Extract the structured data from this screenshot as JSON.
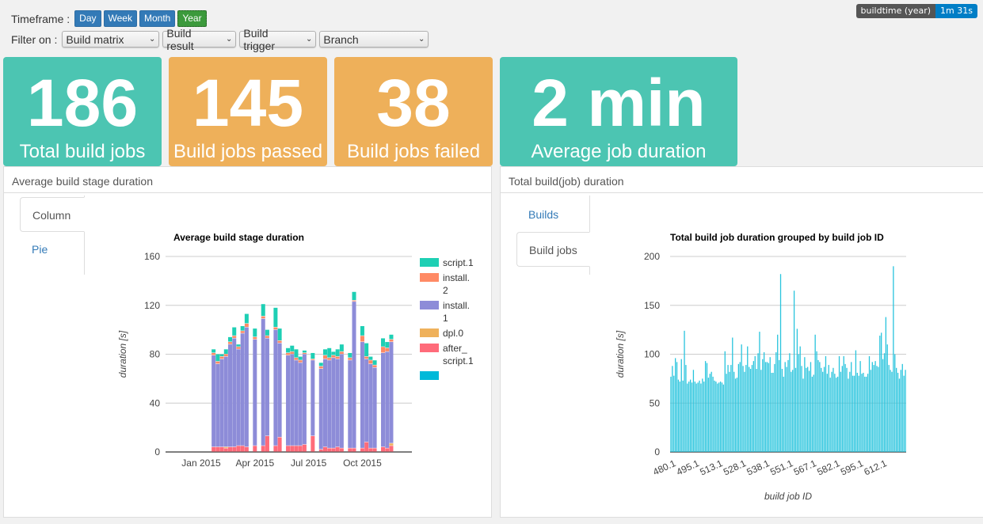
{
  "toolbar": {
    "timeframe_label": "Timeframe :",
    "timeframe_buttons": [
      {
        "label": "Day",
        "active": false
      },
      {
        "label": "Week",
        "active": false
      },
      {
        "label": "Month",
        "active": false
      },
      {
        "label": "Year",
        "active": true
      }
    ],
    "filter_label": "Filter on :",
    "filters": [
      {
        "value": "Build matrix"
      },
      {
        "value": "Build result"
      },
      {
        "value": "Build trigger"
      },
      {
        "value": "Branch"
      }
    ]
  },
  "badge": {
    "key": "buildtime (year)",
    "value": "1m 31s"
  },
  "cards": [
    {
      "value": "186",
      "caption": "Total build jobs",
      "color": "#4cc5b2"
    },
    {
      "value": "145",
      "caption": "Build jobs passed",
      "color": "#eeb05a"
    },
    {
      "value": "38",
      "caption": "Build jobs failed",
      "color": "#eeb05a"
    },
    {
      "value": "2 min",
      "caption": "Average job duration",
      "color": "#4cc5b2"
    }
  ],
  "left_panel": {
    "title": "Average build stage duration",
    "tabs": [
      {
        "label": "Column",
        "active": true
      },
      {
        "label": "Pie",
        "active": false
      }
    ]
  },
  "right_panel": {
    "title": "Total build(job) duration",
    "tabs": [
      {
        "label": "Builds",
        "active": false
      },
      {
        "label": "Build jobs",
        "active": true
      }
    ]
  },
  "chart_data": [
    {
      "type": "bar",
      "stacked": true,
      "title": "Average build stage duration",
      "xlabel": "",
      "ylabel": "duration [s]",
      "ylim": [
        0,
        160
      ],
      "yticks": [
        0,
        40,
        80,
        120,
        160
      ],
      "xticks": [
        "Jan 2015",
        "Apr 2015",
        "Jul 2015",
        "Oct 2015"
      ],
      "x_range_weeks": [
        -3,
        49
      ],
      "grid": true,
      "legend": "right",
      "series": [
        {
          "name": "after_\nscript.1",
          "color": "#ff6b7a"
        },
        {
          "name": "dpl.0",
          "color": "#efb15b"
        },
        {
          "name": "install.1",
          "color": "#8d8cd8"
        },
        {
          "name": "install.2",
          "color": "#ff8a65"
        },
        {
          "name": "script.1",
          "color": "#1ecfb4"
        },
        {
          "name": "",
          "color": "#00b9d9"
        }
      ],
      "legend_order": [
        "script.1",
        "install.\n2",
        "install.\n1",
        "dpl.0",
        "after_\nscript.1",
        ""
      ],
      "weeks": [
        {
          "w": 3,
          "after": 4,
          "dpl": 0,
          "inst1": 75,
          "inst2": 2,
          "script": 3
        },
        {
          "w": 4,
          "after": 4,
          "dpl": 0,
          "inst1": 68,
          "inst2": 2,
          "script": 6
        },
        {
          "w": 5,
          "after": 4,
          "dpl": 0,
          "inst1": 72,
          "inst2": 2,
          "script": 2
        },
        {
          "w": 6,
          "after": 3,
          "dpl": 1,
          "inst1": 74,
          "inst2": 2,
          "script": 4
        },
        {
          "w": 7,
          "after": 4,
          "dpl": 0,
          "inst1": 84,
          "inst2": 2,
          "script": 4
        },
        {
          "w": 8,
          "after": 4,
          "dpl": 0,
          "inst1": 89,
          "inst2": 2,
          "script": 7
        },
        {
          "w": 9,
          "after": 5,
          "dpl": 0,
          "inst1": 79,
          "inst2": 2,
          "script": 2
        },
        {
          "w": 10,
          "after": 5,
          "dpl": 0,
          "inst1": 92,
          "inst2": 2,
          "script": 4
        },
        {
          "w": 11,
          "after": 4,
          "dpl": 0,
          "inst1": 98,
          "inst2": 3,
          "script": 8
        },
        {
          "w": 13,
          "after": 5,
          "dpl": 0,
          "inst1": 87,
          "inst2": 2,
          "script": 7
        },
        {
          "w": 15,
          "after": 5,
          "dpl": 0,
          "inst1": 104,
          "inst2": 2,
          "script": 10
        },
        {
          "w": 16,
          "after": 13,
          "dpl": 0,
          "inst1": 80,
          "inst2": 2,
          "script": 5
        },
        {
          "w": 18,
          "after": 5,
          "dpl": 0,
          "inst1": 95,
          "inst2": 2,
          "script": 16
        },
        {
          "w": 19,
          "after": 12,
          "dpl": 0,
          "inst1": 77,
          "inst2": 2,
          "script": 10
        },
        {
          "w": 21,
          "after": 5,
          "dpl": 0,
          "inst1": 74,
          "inst2": 2,
          "script": 4
        },
        {
          "w": 22,
          "after": 5,
          "dpl": 0,
          "inst1": 75,
          "inst2": 2,
          "script": 5
        },
        {
          "w": 23,
          "after": 5,
          "dpl": 0,
          "inst1": 70,
          "inst2": 2,
          "script": 7
        },
        {
          "w": 24,
          "after": 5,
          "dpl": 0,
          "inst1": 68,
          "inst2": 2,
          "script": 3
        },
        {
          "w": 25,
          "after": 6,
          "dpl": 0,
          "inst1": 74,
          "inst2": 1,
          "script": 2
        },
        {
          "w": 27,
          "after": 13,
          "dpl": 0,
          "inst1": 62,
          "inst2": 1,
          "script": 5
        },
        {
          "w": 29,
          "after": 2,
          "dpl": 0,
          "inst1": 66,
          "inst2": 2,
          "script": 3
        },
        {
          "w": 30,
          "after": 4,
          "dpl": 0,
          "inst1": 72,
          "inst2": 3,
          "script": 5
        },
        {
          "w": 31,
          "after": 3,
          "dpl": 0,
          "inst1": 72,
          "inst2": 2,
          "script": 8
        },
        {
          "w": 32,
          "after": 3,
          "dpl": 0,
          "inst1": 74,
          "inst2": 2,
          "script": 3
        },
        {
          "w": 33,
          "after": 4,
          "dpl": 0,
          "inst1": 72,
          "inst2": 2,
          "script": 6
        },
        {
          "w": 34,
          "after": 3,
          "dpl": 0,
          "inst1": 77,
          "inst2": 2,
          "script": 6
        },
        {
          "w": 36,
          "after": 3,
          "dpl": 0,
          "inst1": 72,
          "inst2": 2,
          "script": 4
        },
        {
          "w": 37,
          "after": 3,
          "dpl": 0,
          "inst1": 120,
          "inst2": 1,
          "script": 7
        },
        {
          "w": 39,
          "after": 3,
          "dpl": 0,
          "inst1": 87,
          "inst2": 5,
          "script": 8
        },
        {
          "w": 40,
          "after": 8,
          "dpl": 0,
          "inst1": 68,
          "inst2": 2,
          "script": 11
        },
        {
          "w": 41,
          "after": 3,
          "dpl": 0,
          "inst1": 69,
          "inst2": 3,
          "script": 3
        },
        {
          "w": 42,
          "after": 3,
          "dpl": 0,
          "inst1": 66,
          "inst2": 2,
          "script": 4
        },
        {
          "w": 44,
          "after": 4,
          "dpl": 0,
          "inst1": 77,
          "inst2": 5,
          "script": 7
        },
        {
          "w": 45,
          "after": 3,
          "dpl": 0,
          "inst1": 79,
          "inst2": 3,
          "script": 5
        },
        {
          "w": 46,
          "after": 5,
          "dpl": 2,
          "inst1": 83,
          "inst2": 2,
          "script": 4
        }
      ]
    },
    {
      "type": "bar",
      "title": "Total build job duration grouped by build job ID",
      "xlabel": "build job ID",
      "ylabel": "duration [s]",
      "ylim": [
        0,
        200
      ],
      "yticks": [
        0,
        50,
        100,
        150,
        200
      ],
      "xticks": [
        "480.1",
        "495.1",
        "513.1",
        "528.1",
        "538.1",
        "551.1",
        "567.1",
        "582.1",
        "595.1",
        "612.1"
      ],
      "grid": true,
      "legend": "none",
      "color": "#28c4dd",
      "values": [
        77,
        88,
        78,
        96,
        92,
        74,
        72,
        95,
        73,
        124,
        89,
        70,
        72,
        74,
        71,
        84,
        72,
        70,
        71,
        73,
        70,
        75,
        72,
        93,
        91,
        76,
        80,
        82,
        77,
        73,
        72,
        70,
        71,
        72,
        71,
        69,
        103,
        80,
        89,
        82,
        89,
        117,
        82,
        75,
        76,
        90,
        92,
        110,
        88,
        82,
        89,
        108,
        87,
        85,
        89,
        93,
        98,
        85,
        101,
        123,
        84,
        95,
        102,
        92,
        92,
        91,
        97,
        81,
        81,
        90,
        102,
        120,
        94,
        182,
        85,
        77,
        92,
        87,
        94,
        101,
        82,
        84,
        165,
        86,
        126,
        100,
        108,
        88,
        75,
        97,
        86,
        87,
        83,
        92,
        77,
        79,
        120,
        103,
        94,
        92,
        86,
        82,
        87,
        98,
        80,
        89,
        76,
        82,
        86,
        80,
        76,
        77,
        98,
        82,
        88,
        98,
        90,
        86,
        75,
        82,
        92,
        78,
        78,
        104,
        81,
        78,
        93,
        80,
        81,
        77,
        77,
        80,
        98,
        84,
        92,
        89,
        93,
        88,
        87,
        119,
        122,
        95,
        101,
        138,
        110,
        89,
        84,
        82,
        190,
        100,
        86,
        81,
        75,
        84,
        90,
        78,
        84
      ]
    }
  ]
}
